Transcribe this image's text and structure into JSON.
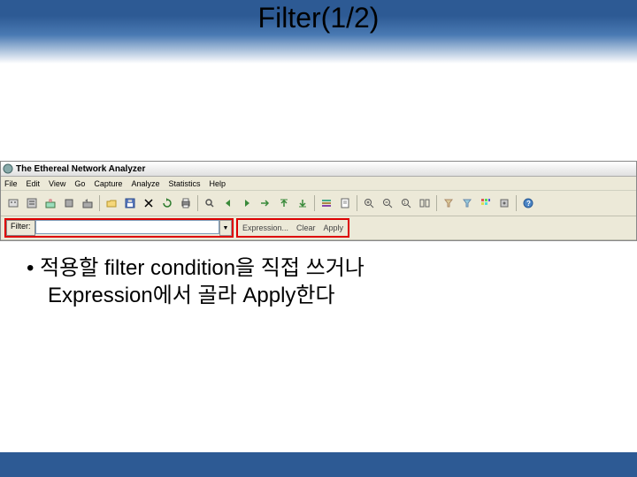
{
  "slide": {
    "title": "Filter(1/2)",
    "bullet_line1": "• 적용할 filter condition을 직접 쓰거나",
    "bullet_line2": "Expression에서 골라 Apply한다"
  },
  "app": {
    "window_title": "The Ethereal Network Analyzer",
    "menu": {
      "file": "File",
      "edit": "Edit",
      "view": "View",
      "go": "Go",
      "capture": "Capture",
      "analyze": "Analyze",
      "statistics": "Statistics",
      "help": "Help"
    },
    "filter": {
      "label": "Filter:",
      "expression_btn": "Expression...",
      "clear_btn": "Clear",
      "apply_btn": "Apply"
    }
  }
}
